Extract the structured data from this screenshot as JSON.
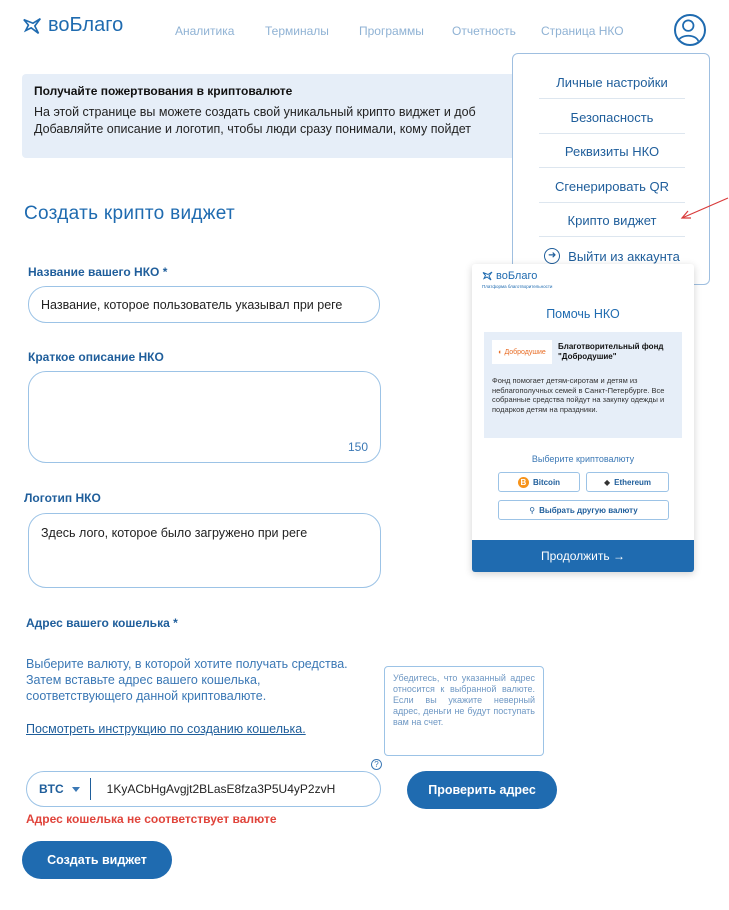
{
  "brand": {
    "name": "воБлаго"
  },
  "nav": [
    {
      "label": "Аналитика"
    },
    {
      "label": "Терминалы"
    },
    {
      "label": "Программы"
    },
    {
      "label": "Отчетность"
    },
    {
      "label": "Страница НКО"
    }
  ],
  "banner": {
    "title": "Получайте пожертвования в криптовалюте",
    "line1": "На этой странице вы можете создать свой уникальный крипто виджет и доб",
    "line2": "Добавляйте описание и логотип, чтобы люди сразу понимали, кому пойдет"
  },
  "menu": {
    "items": [
      {
        "label": "Личные настройки"
      },
      {
        "label": "Безопасность"
      },
      {
        "label": "Реквизиты НКО"
      },
      {
        "label": "Сгенерировать QR"
      },
      {
        "label": "Крипто виджет"
      }
    ],
    "logout": "Выйти из аккаунта"
  },
  "page_title": "Создать крипто виджет",
  "form": {
    "name_label": "Название вашего НКО *",
    "name_value": "Название, которое пользователь указывал при реге",
    "desc_label": "Краткое описание НКО",
    "desc_value": "",
    "desc_counter": "150",
    "logo_label": "Логотип НКО",
    "logo_value": "Здесь лого, которое было загружено при реге",
    "wallet_label": "Адрес вашего кошелька *",
    "wallet_help_1": "Выберите валюту, в которой хотите получать средства.",
    "wallet_help_2": "Затем вставьте адрес вашего кошелька,",
    "wallet_help_3": "соответствующего данной криптовалюте.",
    "instructions_link": "Посмотреть инструкцию по созданию кошелька.",
    "tooltip": "Убедитесь, что указанный адрес относится к выбранной валюте. Если вы укажите неверный адрес, деньги не будут поступать вам на счет.",
    "tooltip_mark": "?",
    "currency": "BTC",
    "address": "1KyACbHgAvgjt2BLasE8fza3P5U4yP2zvH",
    "check_button": "Проверить адрес",
    "error": "Адрес кошелька не соответствует валюте",
    "create_button": "Создать виджет"
  },
  "preview": {
    "brand": "воБлаго",
    "brand_sub": "Платформа благотворительности",
    "heading": "Помочь НКО",
    "fund_logo": "Добродушие",
    "fund_name_1": "Благотворительный фонд",
    "fund_name_2": "\"Добродушие\"",
    "fund_desc": "Фонд помогает детям-сиротам и детям из неблагополучных семей в Санкт-Петербурге. Все собранные средства пойдут на закупку одежды и подарков детям на праздники.",
    "choose_currency": "Выберите криптовалюту",
    "bitcoin": "Bitcoin",
    "bitcoin_symbol": "B",
    "ethereum": "Ethereum",
    "other": "Выбрать другую валюту",
    "continue": "Продолжить →"
  },
  "colors": {
    "accent": "#1f6bb0",
    "error": "#e0443b",
    "banner_bg": "#e6eef8"
  }
}
